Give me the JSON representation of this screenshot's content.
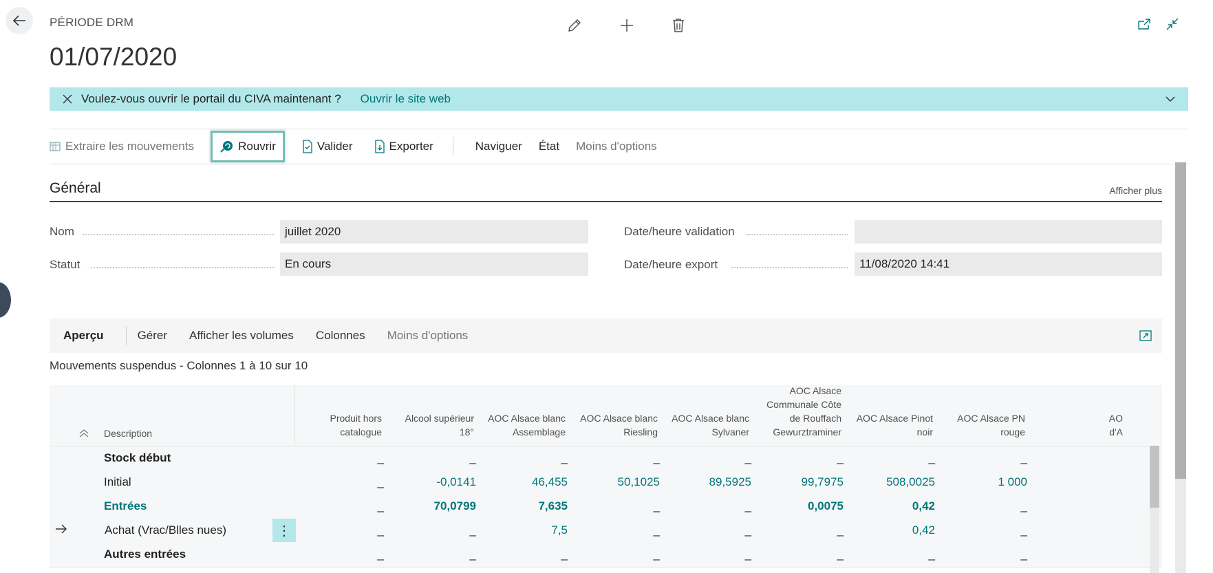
{
  "header": {
    "page_type": "PÉRIODE DRM",
    "title": "01/07/2020"
  },
  "banner": {
    "message": "Voulez-vous ouvrir le portail du CIVA maintenant ?",
    "link": "Ouvrir le site web"
  },
  "actions": {
    "extraire": "Extraire les mouvements",
    "rouvrir": "Rouvrir",
    "valider": "Valider",
    "exporter": "Exporter",
    "naviguer": "Naviguer",
    "etat": "État",
    "moins_options": "Moins d'options"
  },
  "general": {
    "title": "Général",
    "afficher_plus": "Afficher plus",
    "fields": {
      "nom": {
        "label": "Nom",
        "value": "juillet 2020"
      },
      "statut": {
        "label": "Statut",
        "value": "En cours"
      },
      "validation": {
        "label": "Date/heure validation",
        "value": ""
      },
      "export": {
        "label": "Date/heure export",
        "value": "11/08/2020 14:41"
      }
    }
  },
  "subpage": {
    "tabs": {
      "apercu": "Aperçu",
      "gerer": "Gérer",
      "volumes": "Afficher les volumes",
      "colonnes": "Colonnes",
      "moins": "Moins d'options"
    },
    "caption": "Mouvements suspendus - Colonnes 1 à 10 sur 10"
  },
  "grid": {
    "desc_header": "Description",
    "columns": [
      [
        "Produit hors",
        "catalogue"
      ],
      [
        "Alcool supérieur",
        "18°"
      ],
      [
        "AOC Alsace blanc",
        "Assemblage"
      ],
      [
        "AOC Alsace blanc",
        "Riesling"
      ],
      [
        "AOC Alsace blanc",
        "Sylvaner"
      ],
      [
        "AOC Alsace",
        "Communale Côte",
        "de Rouffach",
        "Gewurztraminer"
      ],
      [
        "AOC Alsace Pinot",
        "noir"
      ],
      [
        "AOC Alsace PN",
        "rouge"
      ],
      [
        "AO",
        "d'A"
      ]
    ],
    "rows": [
      {
        "desc": "Stock début",
        "values": [
          "_",
          "_",
          "_",
          "_",
          "_",
          "_",
          "_",
          "_"
        ]
      },
      {
        "desc": "Initial",
        "values": [
          "_",
          "-0,0141",
          "46,455",
          "50,1025",
          "89,5925",
          "99,7975",
          "508,0025",
          "1 000"
        ]
      },
      {
        "desc": "Entrées",
        "values": [
          "_",
          "70,0799",
          "7,635",
          "_",
          "_",
          "0,0075",
          "0,42",
          "_"
        ]
      },
      {
        "desc": "Achat (Vrac/Blles nues)",
        "values": [
          "_",
          "_",
          "7,5",
          "_",
          "_",
          "_",
          "0,42",
          "_"
        ]
      },
      {
        "desc": "Autres entrées",
        "values": [
          "_",
          "_",
          "_",
          "_",
          "_",
          "_",
          "_",
          "_"
        ]
      }
    ]
  },
  "colors": {
    "accent": "#00767a",
    "banner": "#b3e8ea",
    "focus_border": "#6fc1b4"
  },
  "icons": [
    "back-arrow-icon",
    "edit-pencil-icon",
    "new-plus-icon",
    "delete-icon",
    "open-new-window-icon",
    "collapse-icon",
    "close-icon",
    "chevron-down-icon",
    "extract-icon",
    "rouvrir-icon",
    "valider-icon",
    "exporter-icon",
    "expand-icon",
    "sort-icon",
    "row-arrow-icon",
    "row-menu-icon"
  ]
}
